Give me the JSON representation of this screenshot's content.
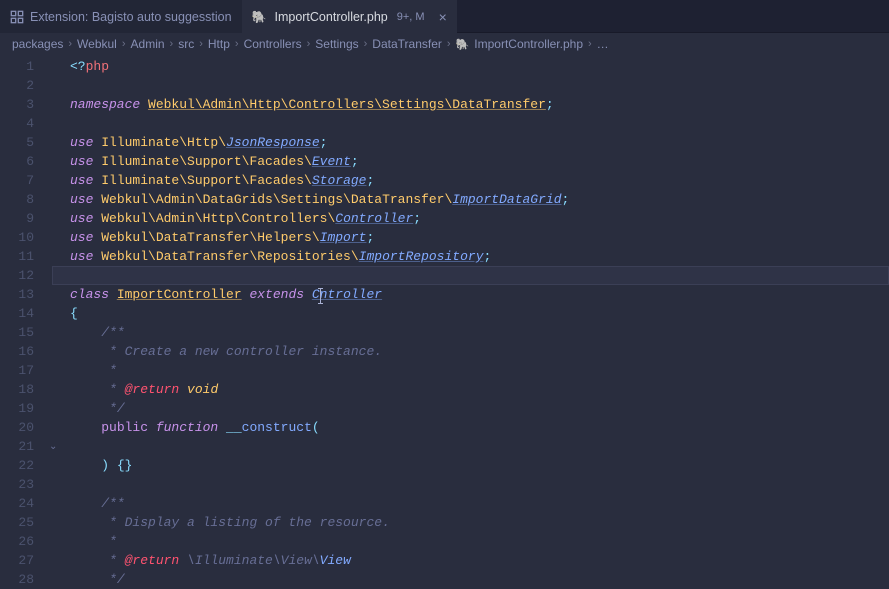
{
  "tabs": {
    "inactive": {
      "label": "Extension: Bagisto auto suggesstion"
    },
    "active": {
      "label": "ImportController.php",
      "suffix": "9+, M"
    }
  },
  "breadcrumb": [
    "packages",
    "Webkul",
    "Admin",
    "src",
    "Http",
    "Controllers",
    "Settings",
    "DataTransfer",
    "ImportController.php",
    "…"
  ],
  "code": {
    "l1_open": "<?",
    "l1_php": "php",
    "l3_kw": "namespace ",
    "l3_ns": "Webkul\\Admin\\Http\\Controllers\\Settings\\DataTransfer",
    "l3_sc": ";",
    "use": "use ",
    "l5_ns": "Illuminate\\Http\\",
    "l5_cls": "JsonResponse",
    "sc": ";",
    "l6_ns": "Illuminate\\Support\\Facades\\",
    "l6_cls": "Event",
    "l7_ns": "Illuminate\\Support\\Facades\\",
    "l7_cls": "Storage",
    "l8_ns": "Webkul\\Admin\\DataGrids\\Settings\\DataTransfer\\",
    "l8_cls": "ImportDataGrid",
    "l9_ns": "Webkul\\Admin\\Http\\Controllers\\",
    "l9_cls": "Controller",
    "l10_ns": "Webkul\\DataTransfer\\Helpers\\",
    "l10_cls": "Import",
    "l11_ns": "Webkul\\DataTransfer\\Repositories\\",
    "l11_cls": "ImportRepository",
    "l13_class": "class ",
    "l13_name": "ImportController",
    "l13_ext": " extends ",
    "l13_parent1": "C",
    "l13_parent2": "ntroller",
    "brace_open": "{",
    "brace_close": "}",
    "doc_open": "/**",
    "doc_mid": " * ",
    "doc_star": " *",
    "doc_close": " */",
    "l16": " * Create a new controller instance.",
    "l18_ret": "@return ",
    "l18_void": "void",
    "l20_pub": "public ",
    "l20_fn": "function ",
    "l20_mag": "__",
    "l20_name": "construct",
    "l20_par": "(",
    "l22_close": ") ",
    "l22_b": "{}",
    "l25": " * Display a listing of the resource.",
    "l27_ret": "@return ",
    "l27_ns": "\\Illuminate\\View\\",
    "l27_cls": "View"
  }
}
